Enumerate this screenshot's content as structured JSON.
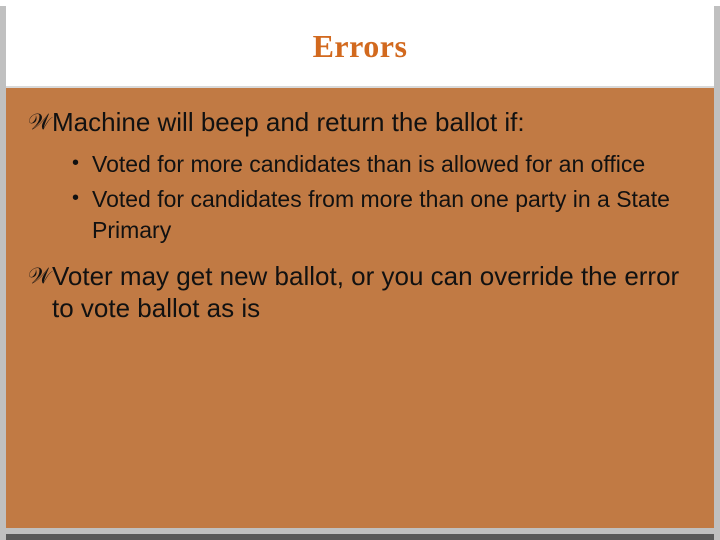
{
  "title": "Errors",
  "bullets": {
    "main1": "Machine will beep and return the ballot if:",
    "sub1": "Voted for more candidates than is allowed for an office",
    "sub2": "Voted for candidates from more than one party in a State Primary",
    "main2": "Voter may get new ballot, or you can override the error to vote ballot as is"
  },
  "glyphs": {
    "swash": "་",
    "dot": "•"
  }
}
